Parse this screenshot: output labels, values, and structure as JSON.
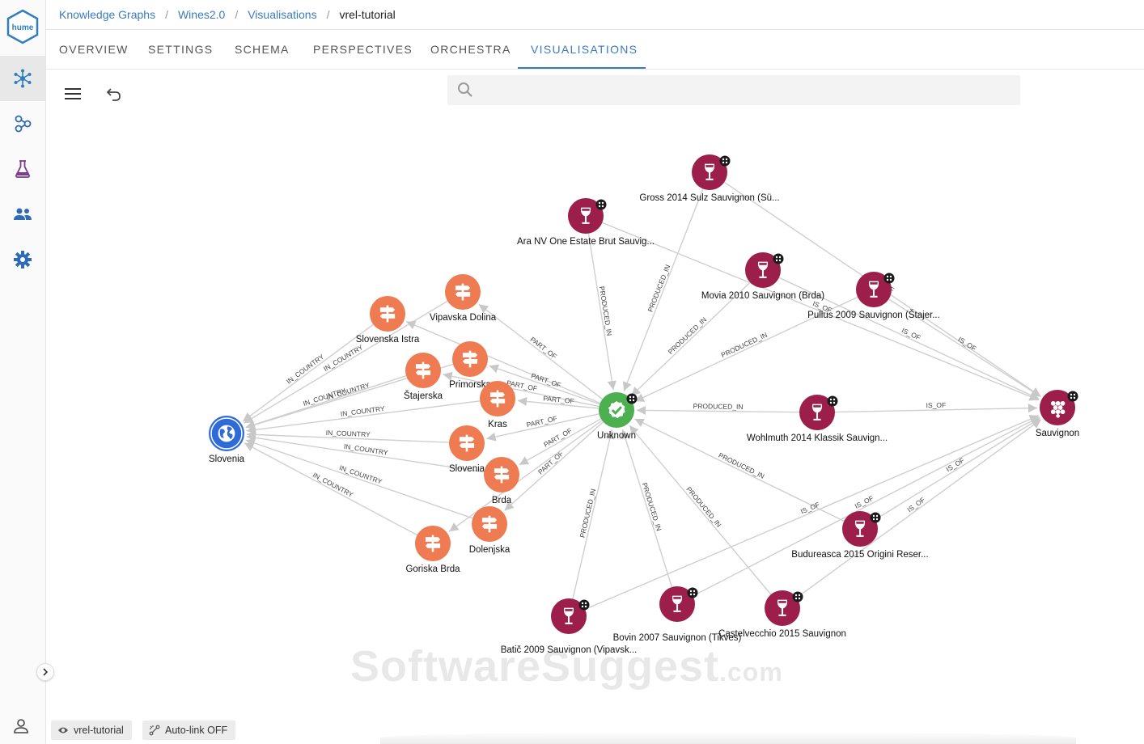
{
  "app": {
    "logo_text": "hume"
  },
  "breadcrumb": [
    "Knowledge Graphs",
    "Wines2.0",
    "Visualisations",
    "vrel-tutorial"
  ],
  "tabs": [
    "OVERVIEW",
    "SETTINGS",
    "SCHEMA",
    "PERSPECTIVES",
    "ORCHESTRA",
    "VISUALISATIONS"
  ],
  "active_tab": "VISUALISATIONS",
  "search": {
    "placeholder": "",
    "value": ""
  },
  "sidebar_icons": [
    "graph-icon",
    "schema-icon",
    "flask-icon",
    "people-icon",
    "gear-icon"
  ],
  "colors": {
    "accent": "#3a7bbf",
    "region": "#ee7b51",
    "wine": "#9b1f4a",
    "unknown": "#4caf50",
    "country": "#2f6bd8",
    "grape": "#9b1f4a",
    "edge": "#cfcfcf"
  },
  "graph": {
    "nodes": [
      {
        "id": "slovenia",
        "label": "Slovenia",
        "type": "country"
      },
      {
        "id": "unknown",
        "label": "Unknown",
        "type": "unknown",
        "badge": true
      },
      {
        "id": "sauvignon",
        "label": "Sauvignon",
        "type": "grape",
        "badge": true
      },
      {
        "id": "vipavska",
        "label": "Vipavska Dolina",
        "type": "region"
      },
      {
        "id": "istra",
        "label": "Slovenska Istra",
        "type": "region"
      },
      {
        "id": "primorska",
        "label": "Primorska",
        "type": "region"
      },
      {
        "id": "stajerska",
        "label": "Štajerska",
        "type": "region"
      },
      {
        "id": "kras",
        "label": "Kras",
        "type": "region"
      },
      {
        "id": "slovenia2",
        "label": "Slovenia",
        "type": "region"
      },
      {
        "id": "brda",
        "label": "Brda",
        "type": "region"
      },
      {
        "id": "dolenjska",
        "label": "Dolenjska",
        "type": "region"
      },
      {
        "id": "goriska",
        "label": "Goriska Brda",
        "type": "region"
      },
      {
        "id": "gross",
        "label": "Gross 2014 Sulz Sauvignon (Sü...",
        "type": "wine",
        "badge": true
      },
      {
        "id": "ara",
        "label": "Ara NV One Estate Brut Sauvig...",
        "type": "wine",
        "badge": true
      },
      {
        "id": "movia",
        "label": "Movia 2010 Sauvignon (Brda)",
        "type": "wine",
        "badge": true
      },
      {
        "id": "pullus",
        "label": "Pullus 2009 Sauvignon (Štajer...",
        "type": "wine",
        "badge": true
      },
      {
        "id": "wohlmuth",
        "label": "Wohlmuth 2014 Klassik Sauvign...",
        "type": "wine",
        "badge": true
      },
      {
        "id": "budureasca",
        "label": "Budureasca 2015 Origini Reser...",
        "type": "wine",
        "badge": true
      },
      {
        "id": "batic",
        "label": "Batič 2009 Sauvignon (Vipavsk...",
        "type": "wine",
        "badge": true
      },
      {
        "id": "bovin",
        "label": "Bovin 2007 Sauvignon (Tikves)",
        "type": "wine",
        "badge": true
      },
      {
        "id": "castel",
        "label": "Castelvecchio 2015 Sauvignon",
        "type": "wine",
        "badge": true
      }
    ],
    "edges": [
      {
        "from": "istra",
        "to": "slovenia",
        "label": "IN_COUNTRY"
      },
      {
        "from": "vipavska",
        "to": "slovenia",
        "label": "IN_COUNTRY"
      },
      {
        "from": "primorska",
        "to": "slovenia",
        "label": "IN_COUNTRY"
      },
      {
        "from": "stajerska",
        "to": "slovenia",
        "label": "IN_COUNTRY"
      },
      {
        "from": "kras",
        "to": "slovenia",
        "label": "IN_COUNTRY"
      },
      {
        "from": "slovenia2",
        "to": "slovenia",
        "label": "IN_COUNTRY"
      },
      {
        "from": "brda",
        "to": "slovenia",
        "label": "IN_COUNTRY"
      },
      {
        "from": "dolenjska",
        "to": "slovenia",
        "label": "IN_COUNTRY"
      },
      {
        "from": "goriska",
        "to": "slovenia",
        "label": "IN_COUNTRY"
      },
      {
        "from": "unknown",
        "to": "vipavska",
        "label": "PART_OF"
      },
      {
        "from": "unknown",
        "to": "istra",
        "label": ""
      },
      {
        "from": "unknown",
        "to": "primorska",
        "label": "PART_OF"
      },
      {
        "from": "unknown",
        "to": "stajerska",
        "label": "PART_OF"
      },
      {
        "from": "unknown",
        "to": "kras",
        "label": "PART_OF"
      },
      {
        "from": "unknown",
        "to": "slovenia2",
        "label": "PART_OF"
      },
      {
        "from": "unknown",
        "to": "brda",
        "label": "PART_OF"
      },
      {
        "from": "unknown",
        "to": "dolenjska",
        "label": "PART_OF"
      },
      {
        "from": "unknown",
        "to": "goriska",
        "label": ""
      },
      {
        "from": "ara",
        "to": "unknown",
        "label": "PRODUCED_IN"
      },
      {
        "from": "gross",
        "to": "unknown",
        "label": "PRODUCED_IN"
      },
      {
        "from": "movia",
        "to": "unknown",
        "label": "PRODUCED_IN"
      },
      {
        "from": "pullus",
        "to": "unknown",
        "label": "PRODUCED_IN"
      },
      {
        "from": "wohlmuth",
        "to": "unknown",
        "label": "PRODUCED_IN"
      },
      {
        "from": "budureasca",
        "to": "unknown",
        "label": "PRODUCED_IN"
      },
      {
        "from": "batic",
        "to": "unknown",
        "label": "PRODUCED_IN"
      },
      {
        "from": "bovin",
        "to": "unknown",
        "label": "PRODUCED_IN"
      },
      {
        "from": "castel",
        "to": "unknown",
        "label": "PRODUCED_IN"
      },
      {
        "from": "gross",
        "to": "sauvignon",
        "label": "IS_OF"
      },
      {
        "from": "ara",
        "to": "sauvignon",
        "label": "IS_OF"
      },
      {
        "from": "movia",
        "to": "sauvignon",
        "label": "IS_OF"
      },
      {
        "from": "pullus",
        "to": "sauvignon",
        "label": "IS_OF"
      },
      {
        "from": "wohlmuth",
        "to": "sauvignon",
        "label": "IS_OF"
      },
      {
        "from": "budureasca",
        "to": "sauvignon",
        "label": "IS_OF"
      },
      {
        "from": "batic",
        "to": "sauvignon",
        "label": "IS_OF"
      },
      {
        "from": "bovin",
        "to": "sauvignon",
        "label": "IS_OF"
      },
      {
        "from": "castel",
        "to": "sauvignon",
        "label": "IS_OF"
      }
    ]
  },
  "status_chips": {
    "perspective": "vrel-tutorial",
    "autolink": "Auto-link OFF"
  },
  "watermark": {
    "main": "SoftwareSuggest",
    "suffix": ".com"
  }
}
